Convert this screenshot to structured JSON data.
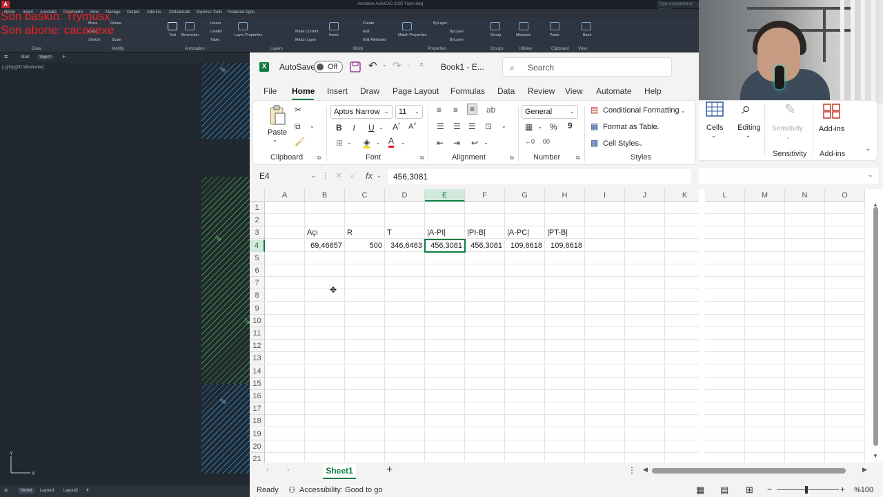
{
  "acad": {
    "window_title": "Autodesk AutoCAD 2025   Yayın.dwg",
    "search_placeholder": "Type a keyword or phrase",
    "ribbon_tabs": [
      "Home",
      "Insert",
      "Annotate",
      "Parametric",
      "View",
      "Manage",
      "Output",
      "Add-ins",
      "Collaborate",
      "Express Tools",
      "Featured Apps"
    ],
    "ribbon_groups": [
      "Draw",
      "Modify",
      "Annotation",
      "Layers",
      "Block",
      "Properties",
      "Groups",
      "Utilities",
      "Clipboard",
      "View"
    ],
    "ribbon_items": {
      "move": "Move",
      "rotate": "Rotate",
      "copy": "Copy",
      "stretch": "Stretch",
      "scale": "Scale",
      "text": "Text",
      "dimension": "Dimension",
      "linear": "Linear",
      "leader": "Leader",
      "table": "Table",
      "layer_properties": "Layer Properties",
      "make_current": "Make Current",
      "match_layer": "Match Layer",
      "insert": "Insert",
      "create": "Create",
      "edit": "Edit",
      "edit_attributes": "Edit Attributes",
      "match_properties": "Match Properties",
      "bylayer": "ByLayer",
      "group": "Group",
      "measure": "Measure",
      "paste": "Paste",
      "base": "Base"
    },
    "file_tabs": [
      "Start",
      "Yayın*"
    ],
    "viewport_label": "[–][Top][2D Wireframe]",
    "layout_tabs": [
      "Model",
      "Layout1",
      "Layout2"
    ],
    "hatch_labels": [
      "690",
      "740",
      "710",
      "690"
    ]
  },
  "overlay": {
    "line1": "Son baskın: Trymusx",
    "line2": "Son abone: cacanexe"
  },
  "excel": {
    "app_letter": "X",
    "autosave_label": "AutoSave",
    "autosave_state": "Off",
    "doc_title": "Book1 - E...",
    "search_placeholder": "Search",
    "tabs": [
      "File",
      "Home",
      "Insert",
      "Draw",
      "Page Layout",
      "Formulas",
      "Data",
      "Review",
      "View",
      "Automate",
      "Help"
    ],
    "ribbon": {
      "paste": "Paste",
      "clipboard": "Clipboard",
      "font_name": "Aptos Narrow",
      "font_size": "11",
      "font_group": "Font",
      "bold": "B",
      "italic": "I",
      "underline": "U",
      "alignment_group": "Alignment",
      "number_format": "General",
      "number_group": "Number",
      "conditional_formatting": "Conditional Formatting",
      "format_as_table": "Format as Table",
      "cell_styles": "Cell Styles",
      "styles_group": "Styles",
      "cells": "Cells",
      "editing": "Editing",
      "sensitivity": "Sensitivity",
      "sensitivity_group": "Sensitivity",
      "addins": "Add-ins",
      "addins_group": "Add-ins"
    },
    "name_box": "E4",
    "formula_value": "456,3081",
    "columns": [
      "A",
      "B",
      "C",
      "D",
      "E",
      "F",
      "G",
      "H",
      "I",
      "J",
      "K",
      "L",
      "M",
      "N",
      "O"
    ],
    "selected_column": "E",
    "rows": [
      "1",
      "2",
      "3",
      "4",
      "5",
      "6",
      "7",
      "8",
      "9",
      "10",
      "11",
      "12",
      "13",
      "14",
      "15",
      "16",
      "17",
      "18",
      "19",
      "20",
      "21"
    ],
    "selected_row": "4",
    "headers_row3": {
      "B": "Açı",
      "C": "R",
      "D": "T",
      "E": "|A-PI|",
      "F": "|PI-B|",
      "G": "|A-PC|",
      "H": "|PT-B|"
    },
    "values_row4": {
      "B": "69,46657",
      "C": "500",
      "D": "346,6463",
      "E": "456,3081",
      "F": "456,3081",
      "G": "109,6618",
      "H": "109,6618"
    },
    "sheet_name": "Sheet1",
    "status_ready": "Ready",
    "status_accessibility": "Accessibility: Good to go",
    "zoom": "%100"
  },
  "colors": {
    "excel_green": "#107c41",
    "overlay_red": "#ff2222",
    "acad_bg": "#212830"
  }
}
